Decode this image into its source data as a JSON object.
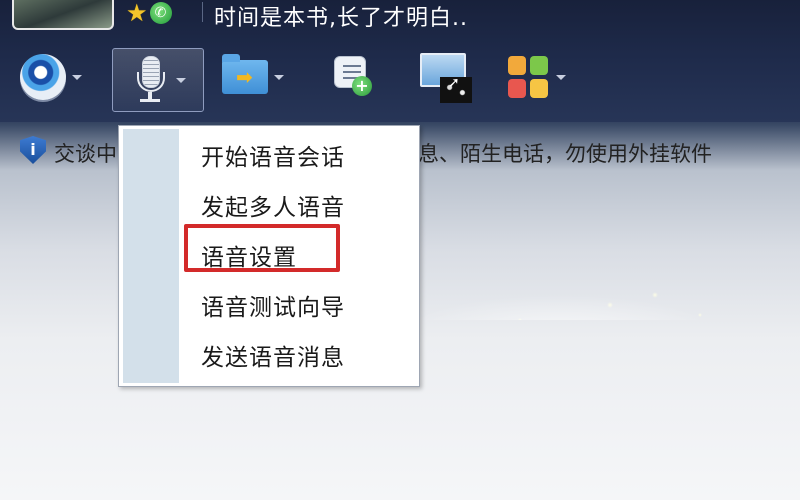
{
  "header": {
    "signature": "时间是本书,长了才明白..",
    "status_icons": [
      "star-icon",
      "phone-icon"
    ]
  },
  "toolbar": {
    "tools": [
      {
        "name": "camera",
        "icon": "webcam-icon",
        "has_dropdown": true
      },
      {
        "name": "voice",
        "icon": "microphone-icon",
        "has_dropdown": true,
        "active": true
      },
      {
        "name": "file-transfer",
        "icon": "folder-send-icon",
        "has_dropdown": true
      },
      {
        "name": "create-note",
        "icon": "note-add-icon",
        "has_dropdown": false
      },
      {
        "name": "remote-screen",
        "icon": "screen-share-icon",
        "has_dropdown": false
      },
      {
        "name": "apps",
        "icon": "apps-grid-icon",
        "has_dropdown": true
      }
    ]
  },
  "info_bar": {
    "icon": "shield-info-icon",
    "text_left": "交谈中",
    "text_right": "息、陌生电话，勿使用外挂软件"
  },
  "voice_menu": {
    "items": [
      {
        "label": "开始语音会话"
      },
      {
        "label": "发起多人语音"
      },
      {
        "label": "语音设置",
        "highlighted": true
      },
      {
        "label": "语音测试向导"
      },
      {
        "label": "发送语音消息"
      }
    ],
    "highlight_color": "#d32a2a"
  },
  "colors": {
    "topbar": "#1e2a4a",
    "menu_gutter": "#d3e0ea",
    "apps_tiles": [
      "#f2a93b",
      "#7cc84a",
      "#e8574f",
      "#f6c544"
    ]
  }
}
